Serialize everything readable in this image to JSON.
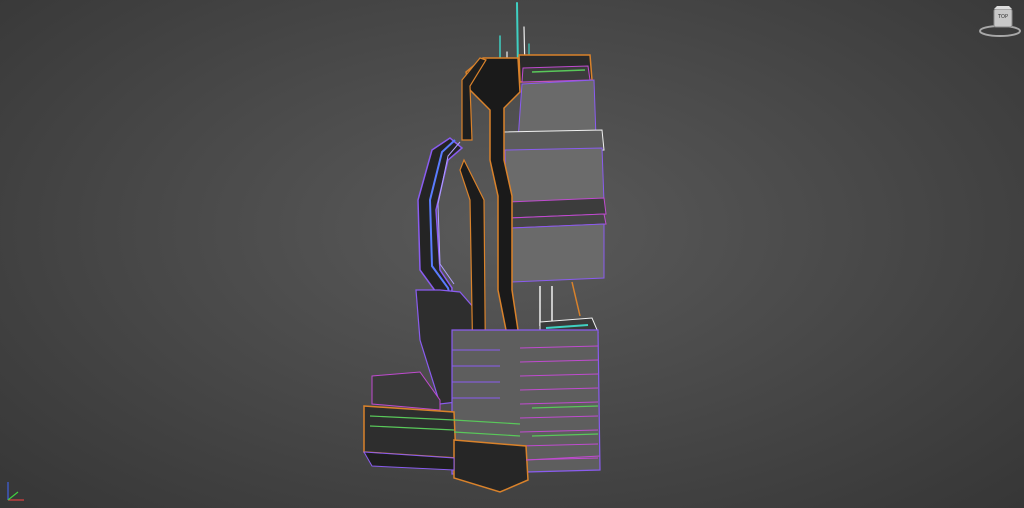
{
  "viewport": {
    "content": "3d-building-model-wireframe",
    "background_color": "#474747",
    "wire_colors": {
      "orange": "#d9822b",
      "purple": "#8a5cf0",
      "magenta": "#c04bd0",
      "green": "#59c85a",
      "cyan": "#3fd0c2",
      "white": "#f0f0f0"
    }
  },
  "viewcube": {
    "face_label": "TOP",
    "icon": "viewcube-icon"
  },
  "axis_gizmo": {
    "icon": "axis-tripod-icon",
    "x_color": "#e04040",
    "y_color": "#40d040",
    "z_color": "#4060e0"
  }
}
